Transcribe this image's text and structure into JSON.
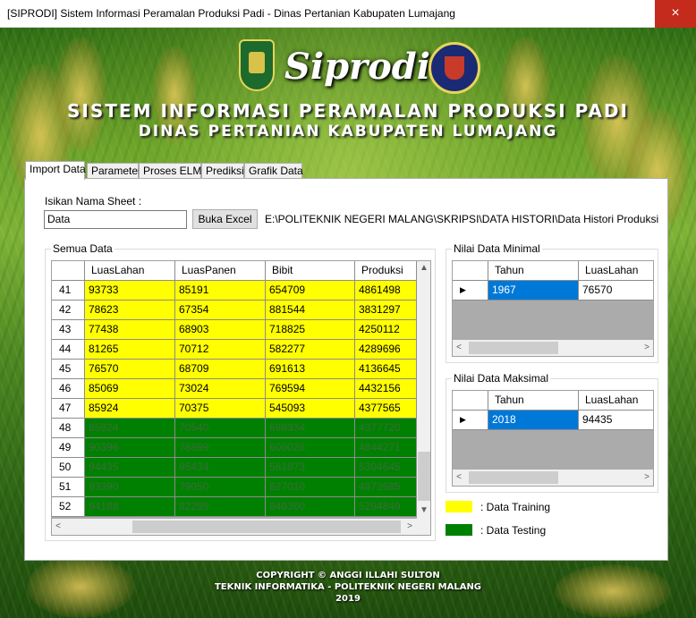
{
  "window": {
    "title": "[SIPRODI] Sistem Informasi Peramalan Produksi Padi - Dinas Pertanian Kabupaten Lumajang",
    "close_glyph": "×"
  },
  "header": {
    "brand": "Siprodi",
    "title_line1": "SISTEM INFORMASI PERAMALAN PRODUKSI PADI",
    "title_line2": "DINAS PERTANIAN KABUPATEN LUMAJANG",
    "logo_left": "kabupaten-lumajang-emblem",
    "logo_right": "politeknik-negeri-malang-emblem"
  },
  "tabs": [
    "Import Data",
    "Parameter",
    "Proses ELM",
    "Prediksi",
    "Grafik Data"
  ],
  "active_tab": "Import Data",
  "import": {
    "sheet_label": "Isikan Nama Sheet :",
    "sheet_value": "Data",
    "browse_label": "Buka Excel",
    "file_path": "E:\\POLITEKNIK NEGERI MALANG\\SKRIPSI\\DATA HISTORI\\Data Histori Produksi"
  },
  "all_data": {
    "group_title": "Semua Data",
    "columns": [
      "LuasLahan",
      "LuasPanen",
      "Bibit",
      "Produksi"
    ],
    "rows": [
      {
        "no": "41",
        "values": [
          "93733",
          "85191",
          "654709",
          "4861498"
        ],
        "type": "training"
      },
      {
        "no": "42",
        "values": [
          "78623",
          "67354",
          "881544",
          "3831297"
        ],
        "type": "training"
      },
      {
        "no": "43",
        "values": [
          "77438",
          "68903",
          "718825",
          "4250112"
        ],
        "type": "training"
      },
      {
        "no": "44",
        "values": [
          "81265",
          "70712",
          "582277",
          "4289696"
        ],
        "type": "training"
      },
      {
        "no": "45",
        "values": [
          "76570",
          "68709",
          "691613",
          "4136645"
        ],
        "type": "training"
      },
      {
        "no": "46",
        "values": [
          "85069",
          "73024",
          "769594",
          "4432156"
        ],
        "type": "training"
      },
      {
        "no": "47",
        "values": [
          "85924",
          "70375",
          "545093",
          "4377565"
        ],
        "type": "training"
      },
      {
        "no": "48",
        "values": [
          "85924",
          "70540",
          "698334",
          "4377720"
        ],
        "type": "testing"
      },
      {
        "no": "49",
        "values": [
          "90396",
          "78899",
          "600026",
          "4844271"
        ],
        "type": "testing"
      },
      {
        "no": "50",
        "values": [
          "94435",
          "85434",
          "581873",
          "5304645"
        ],
        "type": "testing"
      },
      {
        "no": "51",
        "values": [
          "93390",
          "79050",
          "827010",
          "4872685"
        ],
        "type": "testing"
      },
      {
        "no": "52",
        "values": [
          "94188",
          "82289",
          "846360",
          "5294849"
        ],
        "type": "testing"
      }
    ]
  },
  "min_data": {
    "group_title": "Nilai Data Minimal",
    "columns": [
      "Tahun",
      "LuasLahan"
    ],
    "row": {
      "marker": "▶",
      "values": [
        "1967",
        "76570"
      ]
    }
  },
  "max_data": {
    "group_title": "Nilai Data Maksimal",
    "columns": [
      "Tahun",
      "LuasLahan"
    ],
    "row": {
      "marker": "▶",
      "values": [
        "2018",
        "94435"
      ]
    }
  },
  "legend": [
    {
      "label": ": Data Training",
      "color": "#ffff00"
    },
    {
      "label": ": Data Testing",
      "color": "#008000"
    }
  ],
  "footer": {
    "line1": "COPYRIGHT © ANGGI ILLAHI SULTON",
    "line2": "TEKNIK INFORMATIKA - POLITEKNIK NEGERI MALANG",
    "line3": "2019"
  },
  "scroll_glyphs": {
    "up": "▲",
    "down": "▼",
    "left": "<",
    "right": ">"
  }
}
